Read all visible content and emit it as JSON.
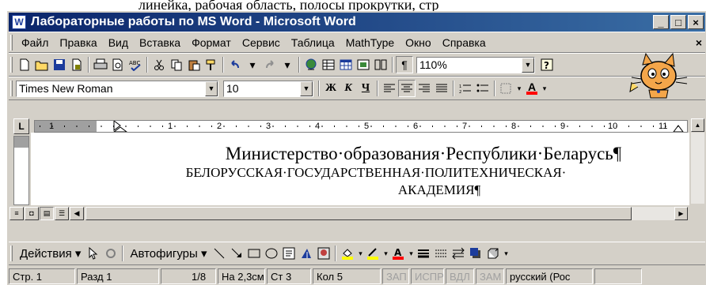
{
  "top_text": "линейка, рабочая область, полосы прокрутки, стр",
  "window": {
    "title": "Лабораторные работы по MS Word - Microsoft Word",
    "minimize": "_",
    "maximize": "□",
    "close": "×"
  },
  "menu": {
    "items": [
      "Файл",
      "Правка",
      "Вид",
      "Вставка",
      "Формат",
      "Сервис",
      "Таблица",
      "MathType",
      "Окно",
      "Справка"
    ],
    "close": "×"
  },
  "standard_toolbar": {
    "zoom": "110%",
    "paragraph_mark": "¶"
  },
  "format_toolbar": {
    "font": "Times New Roman",
    "size": "10",
    "bold": "Ж",
    "italic": "К",
    "underline": "Ч",
    "font_color_letter": "A"
  },
  "ruler": {
    "tab_button": "L",
    "numbers": [
      "1",
      "1",
      "2",
      "3",
      "4",
      "5",
      "6",
      "7",
      "8",
      "9",
      "10",
      "11"
    ]
  },
  "document": {
    "line1": "Министерство·образования·Республики·Беларусь¶",
    "line2": "БЕЛОРУССКАЯ·ГОСУДАРСТВЕННАЯ·ПОЛИТЕХНИЧЕСКАЯ·",
    "line3": "АКАДЕМИЯ¶"
  },
  "drawing_toolbar": {
    "actions": "Действия",
    "autoshapes": "Автофигуры"
  },
  "status": {
    "page": "Стр. 1",
    "section": "Разд 1",
    "pages": "1/8",
    "at": "На 2,3см",
    "line": "Ст 3",
    "col": "Кол 5",
    "rec": "ЗАП",
    "trk": "ИСПР",
    "ext": "ВДЛ",
    "ovr": "ЗАМ",
    "lang": "русский (Рос"
  },
  "colors": {
    "title_start": "#0a246a",
    "title_end": "#3a6ea5",
    "face": "#d4d0c8",
    "highlight": "#ffff00",
    "font_red": "#ff0000"
  }
}
